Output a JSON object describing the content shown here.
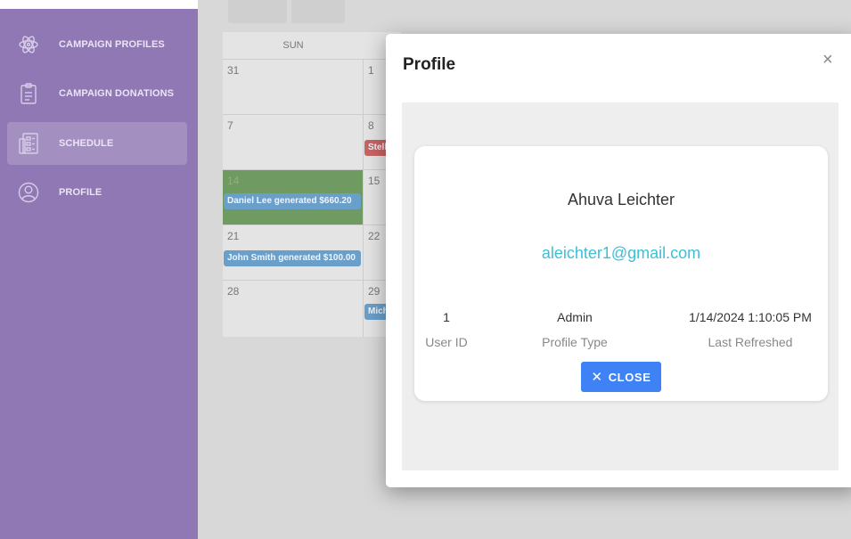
{
  "sidebar": {
    "items": [
      {
        "label": "CAMPAIGN PROFILES",
        "icon": "atom-icon"
      },
      {
        "label": "CAMPAIGN DONATIONS",
        "icon": "clipboard-icon"
      },
      {
        "label": "SCHEDULE",
        "icon": "schedule-icon",
        "active": true
      },
      {
        "label": "PROFILE",
        "icon": "user-icon"
      }
    ]
  },
  "calendar": {
    "day_header": "SUN",
    "cells": [
      {
        "num": "31"
      },
      {
        "num": "1"
      },
      {
        "num": "7"
      },
      {
        "num": "8"
      },
      {
        "num": "14"
      },
      {
        "num": "15"
      },
      {
        "num": "21"
      },
      {
        "num": "22"
      },
      {
        "num": "28"
      },
      {
        "num": "29"
      }
    ],
    "events": [
      {
        "text": "Stell"
      },
      {
        "text": "Daniel Lee generated $660.20"
      },
      {
        "text": "John Smith generated $100.00"
      },
      {
        "text": "Mich"
      }
    ]
  },
  "modal": {
    "title": "Profile",
    "close_symbol": "×",
    "name": "Ahuva Leichter",
    "email": "aleichter1@gmail.com",
    "fields": [
      {
        "value": "1",
        "label": "User ID"
      },
      {
        "value": "Admin",
        "label": "Profile Type"
      },
      {
        "value": "1/14/2024 1:10:05 PM",
        "label": "Last Refreshed"
      }
    ],
    "close_button": "CLOSE",
    "close_button_icon": "✕"
  },
  "colors": {
    "sidebar": "#8f78b4",
    "accent_blue": "#3e82f5",
    "email": "#3cc0d8"
  }
}
